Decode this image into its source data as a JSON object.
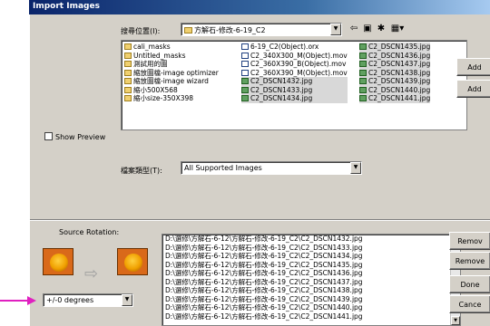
{
  "window": {
    "title": "Import Images"
  },
  "lookin": {
    "label": "搜尋位置(I):",
    "value": "方解石-修改-6-19_C2"
  },
  "toolbar": {
    "back_icon": "back-arrow-icon",
    "up_icon": "up-folder-icon",
    "new_icon": "new-folder-icon",
    "view_icon": "view-menu-icon"
  },
  "files": {
    "col1": [
      {
        "name": "cali_masks",
        "type": "folder"
      },
      {
        "name": "Untitled_masks",
        "type": "folder"
      },
      {
        "name": "測試用的圖",
        "type": "folder"
      },
      {
        "name": "縮放圖檔-image optimizer",
        "type": "folder"
      },
      {
        "name": "縮放圖檔-image wizard",
        "type": "folder"
      },
      {
        "name": "縮小500X568",
        "type": "folder"
      },
      {
        "name": "縮小size-350X398",
        "type": "folder"
      }
    ],
    "col2": [
      {
        "name": "6-19_C2(Object).orx",
        "type": "doc"
      },
      {
        "name": "C2_340X300_M(Object).mov",
        "type": "doc"
      },
      {
        "name": "C2_360X390_B(Object).mov",
        "type": "doc"
      },
      {
        "name": "C2_360X390_M(Object).mov",
        "type": "doc"
      },
      {
        "name": "C2_DSCN1432.jpg",
        "type": "img"
      },
      {
        "name": "C2_DSCN1433.jpg",
        "type": "img"
      },
      {
        "name": "C2_DSCN1434.jpg",
        "type": "img"
      }
    ],
    "col3": [
      {
        "name": "C2_DSCN1435.jpg",
        "type": "img"
      },
      {
        "name": "C2_DSCN1436.jpg",
        "type": "img"
      },
      {
        "name": "C2_DSCN1437.jpg",
        "type": "img"
      },
      {
        "name": "C2_DSCN1438.jpg",
        "type": "img"
      },
      {
        "name": "C2_DSCN1439.jpg",
        "type": "img"
      },
      {
        "name": "C2_DSCN1440.jpg",
        "type": "img"
      },
      {
        "name": "C2_DSCN1441.jpg",
        "type": "img"
      }
    ]
  },
  "buttons": {
    "add": "Add",
    "add_all": "Add",
    "remove": "Remov",
    "remove_all": "Remove",
    "done": "Done",
    "cancel": "Cance"
  },
  "show_preview": {
    "label": "Show Preview"
  },
  "filetype": {
    "label": "檔案類型(T):",
    "value": "All Supported Images"
  },
  "rotation": {
    "label": "Source Rotation:",
    "value": "+/-0 degrees"
  },
  "selected_paths": [
    "D:\\選修\\方解石-6-12\\方解石-修改-6-19_C2\\C2_DSCN1432.jpg",
    "D:\\選修\\方解石-6-12\\方解石-修改-6-19_C2\\C2_DSCN1433.jpg",
    "D:\\選修\\方解石-6-12\\方解石-修改-6-19_C2\\C2_DSCN1434.jpg",
    "D:\\選修\\方解石-6-12\\方解石-修改-6-19_C2\\C2_DSCN1435.jpg",
    "D:\\選修\\方解石-6-12\\方解石-修改-6-19_C2\\C2_DSCN1436.jpg",
    "D:\\選修\\方解石-6-12\\方解石-修改-6-19_C2\\C2_DSCN1437.jpg",
    "D:\\選修\\方解石-6-12\\方解石-修改-6-19_C2\\C2_DSCN1438.jpg",
    "D:\\選修\\方解石-6-12\\方解石-修改-6-19_C2\\C2_DSCN1439.jpg",
    "D:\\選修\\方解石-6-12\\方解石-修改-6-19_C2\\C2_DSCN1440.jpg",
    "D:\\選修\\方解石-6-12\\方解石-修改-6-19_C2\\C2_DSCN1441.jpg"
  ],
  "colors": {
    "pointer": "#e020c0",
    "titlebar": "#0a246a",
    "thumb": "#d9691a"
  }
}
